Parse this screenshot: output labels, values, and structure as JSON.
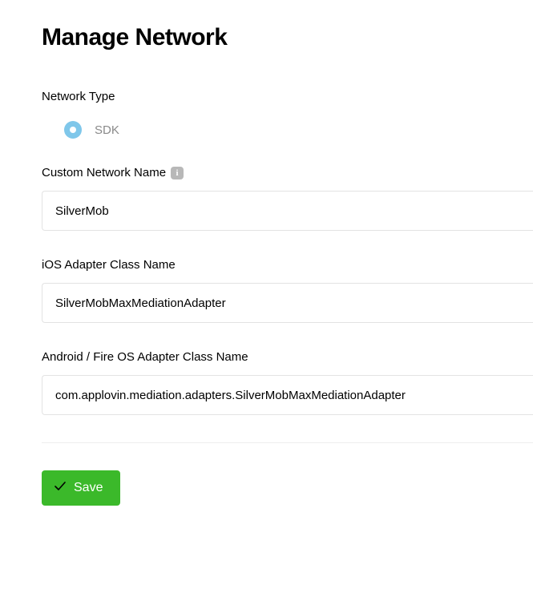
{
  "page": {
    "title": "Manage Network"
  },
  "network_type": {
    "label": "Network Type",
    "option_label": "SDK"
  },
  "custom_network_name": {
    "label": "Custom Network Name",
    "value": "SilverMob"
  },
  "ios_adapter": {
    "label": "iOS Adapter Class Name",
    "value": "SilverMobMaxMediationAdapter"
  },
  "android_adapter": {
    "label": "Android / Fire OS Adapter Class Name",
    "value": "com.applovin.mediation.adapters.SilverMobMaxMediationAdapter"
  },
  "actions": {
    "save_label": "Save"
  }
}
